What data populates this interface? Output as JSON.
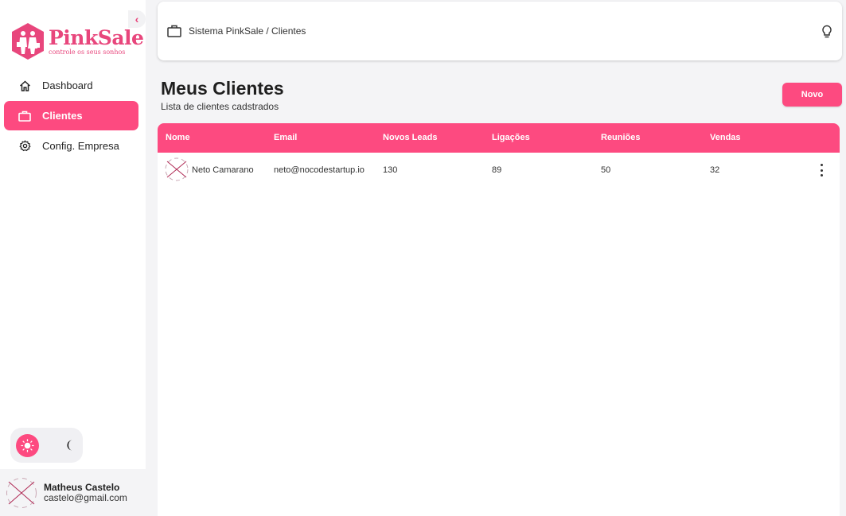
{
  "brand": {
    "name": "PinkSale",
    "tagline": "controle os seus sonhos",
    "accent": "#fd4a80",
    "logo_icon": "shopping-people-hexagon-icon"
  },
  "sidebar": {
    "collapse_icon": "chevron-left-icon",
    "items": [
      {
        "label": "Dashboard",
        "icon": "home-icon",
        "active": false
      },
      {
        "label": "Clientes",
        "icon": "briefcase-icon",
        "active": true
      },
      {
        "label": "Config. Empresa",
        "icon": "gear-icon",
        "active": false
      }
    ],
    "theme": {
      "light_icon": "sun-icon",
      "dark_icon": "moon-icon",
      "selected": "light"
    },
    "user": {
      "name": "Matheus Castelo",
      "email": "castelo@gmail.com"
    }
  },
  "topbar": {
    "breadcrumb": "Sistema PinkSale / Clientes",
    "breadcrumb_icon": "briefcase-icon",
    "tip_icon": "lightbulb-icon"
  },
  "header": {
    "title": "Meus Clientes",
    "subtitle": "Lista de clientes cadstrados",
    "new_button": "Novo"
  },
  "table": {
    "columns": [
      "Nome",
      "Email",
      "Novos Leads",
      "Ligações",
      "Reuniões",
      "Vendas"
    ],
    "rows": [
      {
        "nome": "Neto Camarano",
        "email": "neto@nocodestartup.io",
        "novos_leads": "130",
        "ligacoes": "89",
        "reunioes": "50",
        "vendas": "32"
      }
    ]
  }
}
